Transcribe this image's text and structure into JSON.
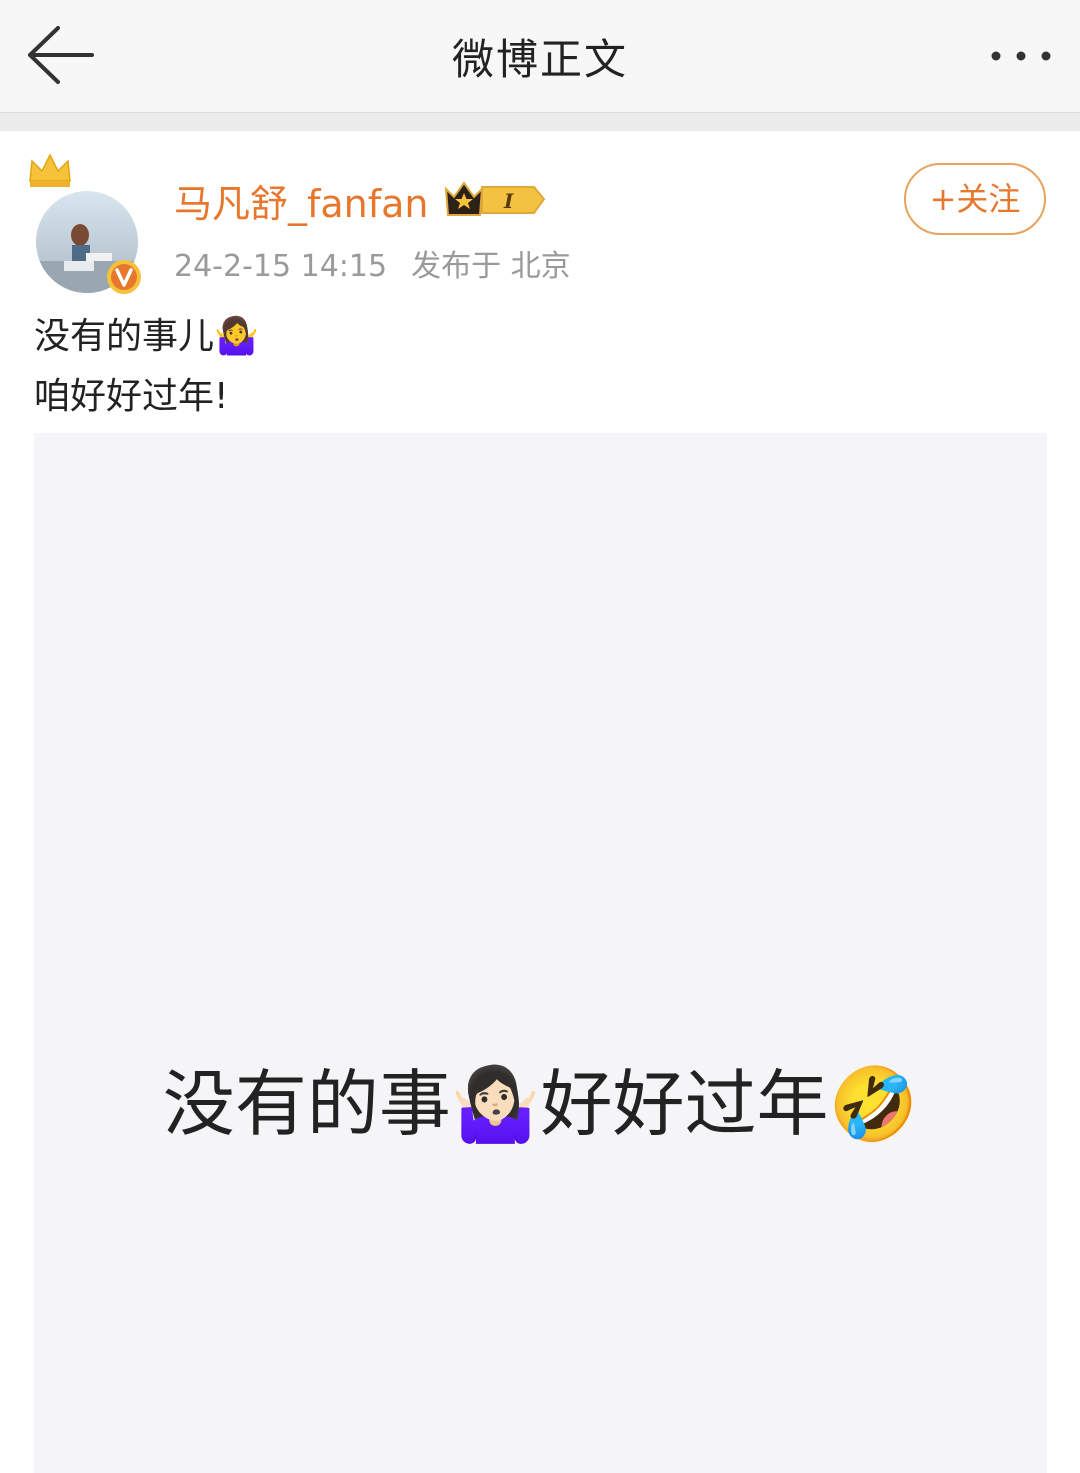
{
  "header": {
    "title": "微博正文"
  },
  "post": {
    "username": "马凡舒_fanfan",
    "timestamp": "24-2-15 14:15",
    "location": "发布于 北京",
    "follow_label": "+关注",
    "text_lines": [
      "没有的事儿🤷‍♀️",
      "咱好好过年!"
    ],
    "image_text": "没有的事🤷🏻‍♀️好好过年🤣"
  },
  "colors": {
    "accent": "#e8772e",
    "meta": "#9a9a9a",
    "header_bg": "#f7f7f7"
  },
  "icons": [
    "back-arrow-icon",
    "more-icon",
    "crown-icon",
    "verified-icon",
    "vip-badge-icon"
  ]
}
